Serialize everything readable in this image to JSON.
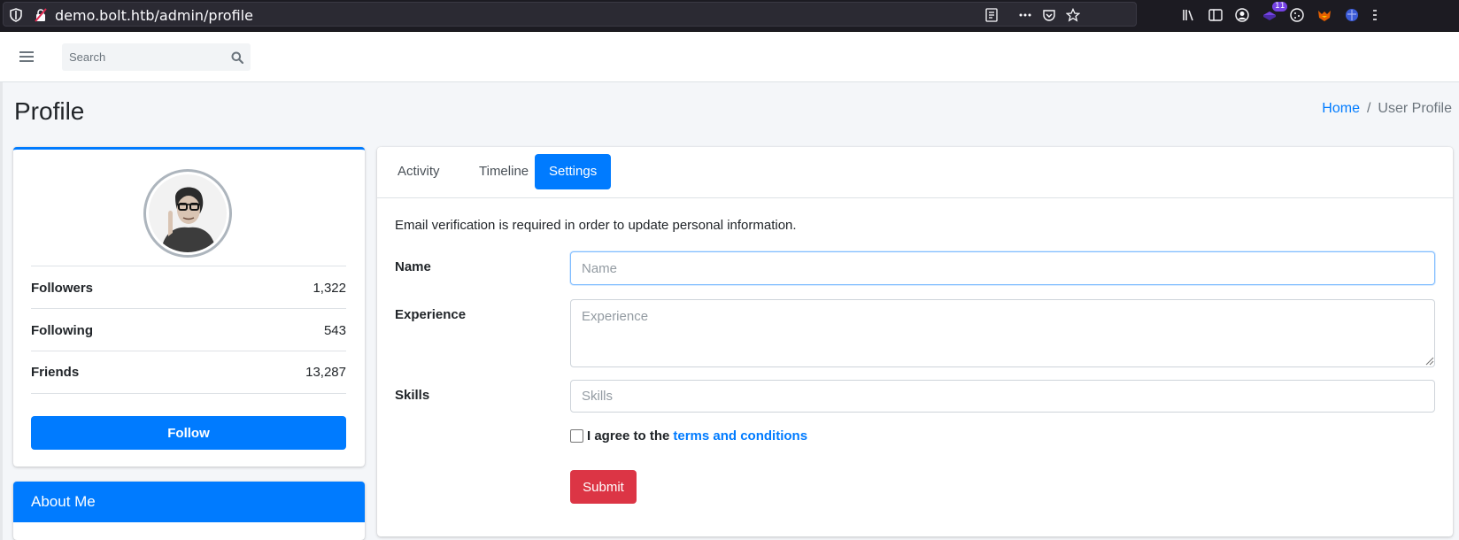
{
  "browser": {
    "url": "demo.bolt.htb/admin/profile",
    "badge_count": "11"
  },
  "navbar": {
    "search_placeholder": "Search"
  },
  "header": {
    "title": "Profile",
    "breadcrumb": [
      {
        "label": "Home"
      },
      {
        "label": "User Profile"
      }
    ]
  },
  "profile": {
    "stats": [
      {
        "label": "Followers",
        "value": "1,322"
      },
      {
        "label": "Following",
        "value": "543"
      },
      {
        "label": "Friends",
        "value": "13,287"
      }
    ],
    "follow_label": "Follow"
  },
  "about": {
    "title": "About Me"
  },
  "tabs": [
    {
      "label": "Activity",
      "active": false
    },
    {
      "label": "Timeline",
      "active": false
    },
    {
      "label": "Settings",
      "active": true
    }
  ],
  "settings": {
    "notice": "Email verification is required in order to update personal information.",
    "fields": {
      "name": {
        "label": "Name",
        "placeholder": "Name",
        "value": ""
      },
      "experience": {
        "label": "Experience",
        "placeholder": "Experience",
        "value": ""
      },
      "skills": {
        "label": "Skills",
        "placeholder": "Skills",
        "value": ""
      }
    },
    "agree_prefix": "I agree to the",
    "agree_link": "terms and conditions",
    "submit_label": "Submit"
  },
  "colors": {
    "primary": "#007bff",
    "danger": "#dc3545",
    "browser_bg": "#1c1b22"
  }
}
